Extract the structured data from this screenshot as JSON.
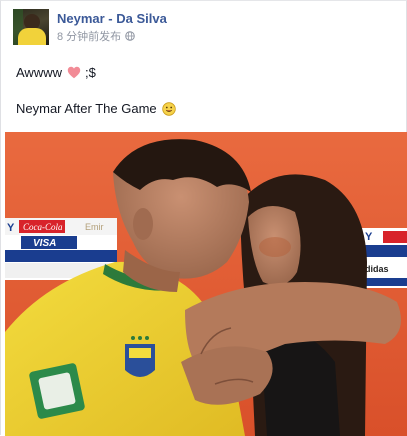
{
  "post": {
    "author": "Neymar - Da Silva",
    "time": "8 分钟前发布",
    "privacy_icon": "globe-icon",
    "line1_text": "Awwww",
    "line1_emoticon": "heart-icon",
    "line1_suffix": ";$",
    "line2_text": "Neymar After The Game",
    "line2_emoticon": "smile-emoji-icon"
  },
  "photo": {
    "description": "",
    "sponsor_labels": {
      "coca": "Coca-Cola",
      "visa": "VISA",
      "emir": "Emir",
      "y_left": "Y",
      "y_right": "Y",
      "adidas": "adidas"
    }
  },
  "colors": {
    "link": "#3b5998",
    "meta": "#9197a3",
    "heart": "#f28b96",
    "backdrop": "#e4572e",
    "jersey": "#f1d23a"
  }
}
